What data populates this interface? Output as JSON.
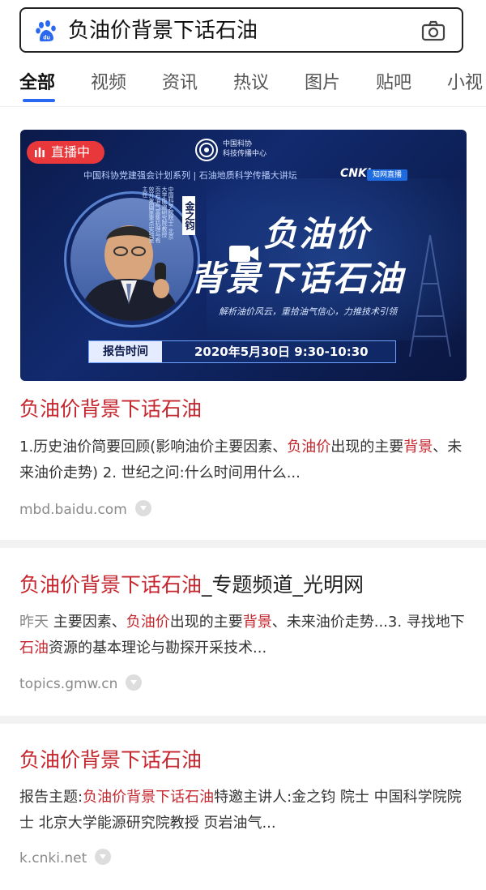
{
  "search": {
    "query": "负油价背景下话石油",
    "logo_icon": "baidu-paw-icon",
    "camera_icon": "camera-icon"
  },
  "tabs": [
    "全部",
    "视频",
    "资讯",
    "热议",
    "图片",
    "贴吧",
    "小视"
  ],
  "active_tab": "全部",
  "colors": {
    "accent": "#2b68f0",
    "link_red": "#c6262e",
    "live_red": "#e8383b",
    "banner_blue": "#0b1a4a"
  },
  "video_card": {
    "live_badge": "直播中",
    "org_name_line1": "中国科协",
    "org_name_line2": "科技传播中心",
    "series": "中国科协党建强会计划系列 | 石油地质科学传播大讲坛",
    "partner_logo": "CNKI",
    "partner_tag": "知网直播",
    "speaker_name": "金之钧",
    "speaker_suffix": "院士",
    "speaker_bio": "中国科学院院士 北京大学能源研究院教授 页岩油气富集机理与有效开发国家重点实验室主任",
    "banner_title_line1": "负油价",
    "banner_title_line2": "背景下话石油",
    "banner_subtitle": "解析油价风云，重拾油气信心，力推技术引领",
    "time_label": "报告时间",
    "time_value": "2020年5月30日    9:30-10:30"
  },
  "results": [
    {
      "title": "负油价背景下话石油",
      "snippet": {
        "p1": "1.历史油价简要回顾(影响油价主要因素、",
        "h1": "负油价",
        "p2": "出现的主要",
        "h2": "背景",
        "p3": "、未来油价走势) 2. 世纪之问:什么时间用什么..."
      },
      "source": "mbd.baidu.com"
    },
    {
      "title_highlight": "负油价背景下话石油",
      "title_rest": "_专题频道_光明网",
      "snippet": {
        "date": "昨天",
        "p1": "主要因素、",
        "h1": "负油价",
        "p2": "出现的主要",
        "h2": "背景",
        "p3": "、未来油价走势...3. 寻找地下",
        "h3": "石油",
        "p4": "资源的基本理论与勘探开采技术..."
      },
      "source": "topics.gmw.cn"
    },
    {
      "title": "负油价背景下话石油",
      "snippet": {
        "p1": "报告主题:",
        "h1": "负油价背景下话石油",
        "p2": "特邀主讲人:金之钧 院士 中国科学院院士 北京大学能源研究院教授 页岩油气..."
      },
      "source": "k.cnki.net"
    }
  ]
}
